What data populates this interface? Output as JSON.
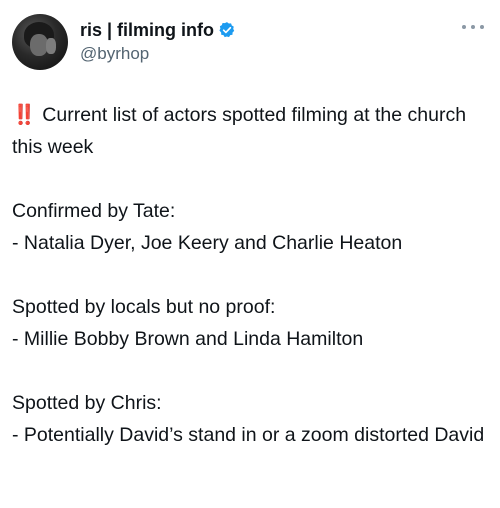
{
  "tweet": {
    "author": {
      "display_name": "ris | filming info",
      "handle": "@byrhop"
    },
    "icons": {
      "verified": "verified-badge-icon",
      "more": "more-options-icon"
    },
    "accent_color": "#1d9bf0",
    "emoji": "‼️",
    "paragraphs": {
      "p1": "Current list of actors spotted filming at the church this week",
      "p2_line1": "Confirmed by Tate:",
      "p2_line2": "- Natalia Dyer, Joe Keery and Charlie Heaton",
      "p3_line1": "Spotted by locals but no proof:",
      "p3_line2": "- Millie Bobby Brown and Linda Hamilton",
      "p4_line1": "Spotted by Chris:",
      "p4_line2": "- Potentially David’s stand in or a zoom distorted David"
    }
  }
}
